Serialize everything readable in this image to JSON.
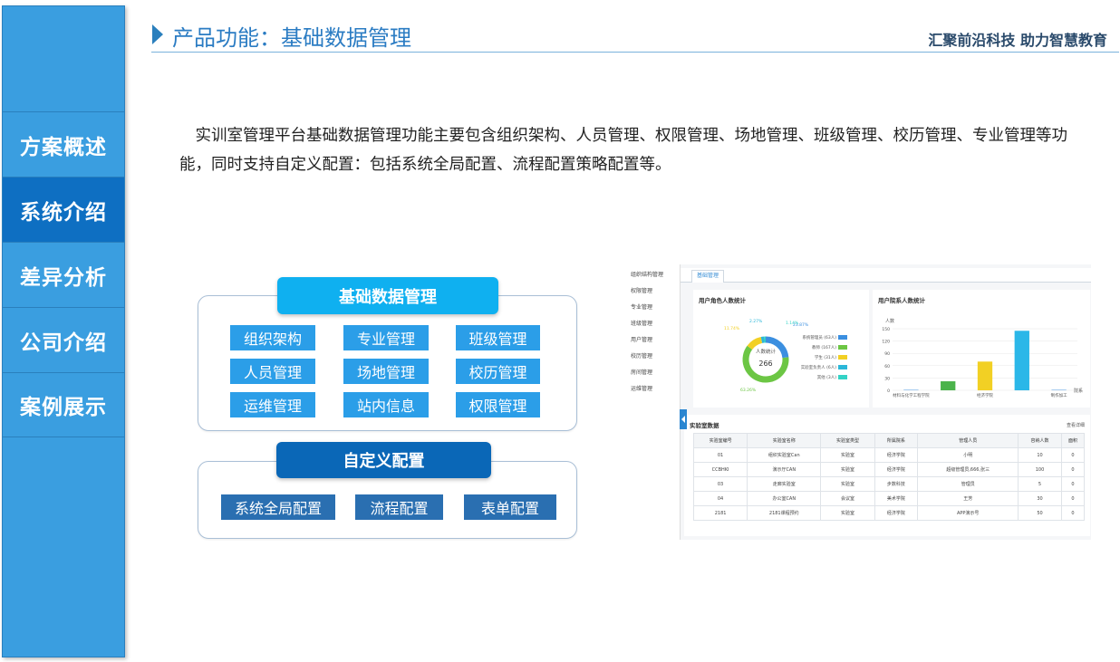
{
  "sidebar": {
    "items": [
      {
        "label": "方案概述"
      },
      {
        "label": "系统介绍"
      },
      {
        "label": "差异分析"
      },
      {
        "label": "公司介绍"
      },
      {
        "label": "案例展示"
      }
    ],
    "active_index": 1
  },
  "header": {
    "title": "产品功能：基础数据管理",
    "slogan": "汇聚前沿科技   助力智慧教育"
  },
  "intro": "实训室管理平台基础数据管理功能主要包含组织架构、人员管理、权限管理、场地管理、班级管理、校历管理、专业管理等功能，同时支持自定义配置：包括系统全局配置、流程配置策略配置等。",
  "diagram": {
    "base": {
      "title": "基础数据管理",
      "items": [
        "组织架构",
        "专业管理",
        "班级管理",
        "人员管理",
        "场地管理",
        "校历管理",
        "运维管理",
        "站内信息",
        "权限管理"
      ]
    },
    "custom": {
      "title": "自定义配置",
      "items": [
        "系统全局配置",
        "流程配置",
        "表单配置"
      ]
    }
  },
  "screenshot": {
    "menu": [
      "组织结构管理",
      "权限管理",
      "专业管理",
      "班级管理",
      "用户管理",
      "校历管理",
      "房间管理",
      "运维管理"
    ],
    "tab": "基础管理",
    "donut": {
      "title": "用户角色人数统计",
      "center_label": "人数统计",
      "center_value": "266",
      "slices": [
        {
          "name": "系统管理员 (63人)",
          "pct": 23.87,
          "label": "23.87%",
          "color": "#3b8fe0"
        },
        {
          "name": "教师 (167人)",
          "pct": 63.26,
          "label": "63.26%",
          "color": "#6cc644"
        },
        {
          "name": "学生 (31人)",
          "pct": 11.74,
          "label": "11.74%",
          "color": "#f2d024"
        },
        {
          "name": "实验室负责人 (6人)",
          "pct": 2.27,
          "label": "2.27%",
          "color": "#2bb7d8"
        },
        {
          "name": "其他 (3人)",
          "pct": 1.14,
          "label": "1.14%",
          "color": "#34d3c6"
        }
      ]
    },
    "bar_chart": {
      "title": "用户院系人数统计",
      "ylabel": "人数",
      "xlabel_end": "院系",
      "yticks": [
        "150",
        "120",
        "90",
        "60",
        "30",
        "0"
      ],
      "categories": [
        "材料与化学工程学院",
        "",
        "经济学院",
        "",
        "制作加工"
      ],
      "values": [
        1,
        22,
        70,
        145,
        1
      ],
      "colors": [
        "#3b8fe0",
        "#4bb34b",
        "#f2d024",
        "#2bb7e8",
        "#3b8fe0"
      ],
      "ymax": 150
    },
    "table": {
      "title": "实验室数据",
      "link": "查看详细",
      "headers": [
        "实验室编号",
        "实验室名称",
        "实验室类型",
        "所属院系",
        "管理人员",
        "容纳人数",
        "面积"
      ],
      "rows": [
        [
          "01",
          "组织实验室Can",
          "实验室",
          "经济学院",
          "小明",
          "10",
          "0"
        ],
        [
          "CCBHKI",
          "演示厅CAN",
          "实验室",
          "经济学院",
          "超级管理员,666,张三",
          "100",
          "0"
        ],
        [
          "03",
          "走廊实验室",
          "实验室",
          "步数科技",
          "管理员",
          "5",
          "0"
        ],
        [
          "04",
          "办公室CAN",
          "会议室",
          "美术学院",
          "王芳",
          "30",
          "0"
        ],
        [
          "2181",
          "2181课程预约",
          "实验室",
          "经济学院",
          "APP演示号",
          "50",
          "0"
        ]
      ]
    }
  }
}
